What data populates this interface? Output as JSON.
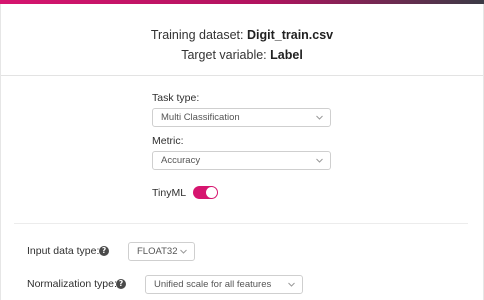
{
  "colors": {
    "accent": "#d6156f",
    "border": "#cfcfcf"
  },
  "header": {
    "dataset_label": "Training dataset:",
    "dataset_value": "Digit_train.csv",
    "target_label": "Target variable:",
    "target_value": "Label"
  },
  "form": {
    "task_type_label": "Task type:",
    "task_type_value": "Multi Classification",
    "metric_label": "Metric:",
    "metric_value": "Accuracy",
    "tinyml_label": "TinyML",
    "tinyml_enabled": true
  },
  "settings": {
    "input_type_label": "Input data type:",
    "input_type_value": "FLOAT32",
    "normalization_label": "Normalization type:",
    "normalization_value": "Unified scale for all features",
    "help_glyph": "?"
  },
  "icons": [
    "chevron-down-icon",
    "question-mark-icon",
    "toggle-switch"
  ]
}
